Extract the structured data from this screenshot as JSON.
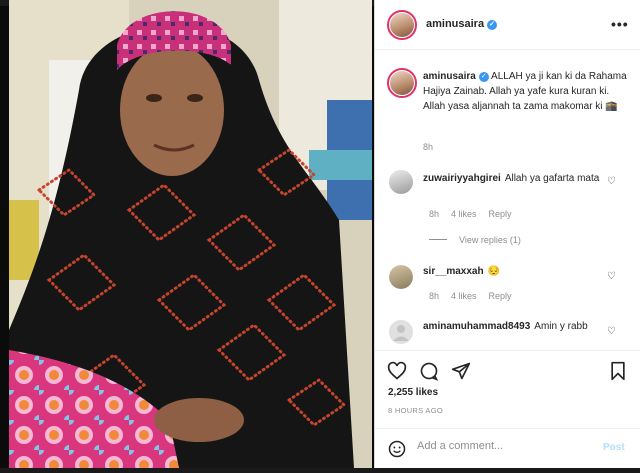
{
  "post": {
    "author": "aminusaira",
    "verified_glyph": "✓"
  },
  "header": {
    "more_glyph": "•••"
  },
  "caption": {
    "username": "aminusaira",
    "text": "ALLAH ya ji kan ki da Rahama Hajiya Zainab. Allah ya yafe kura kuran ki. Allah yasa aljannah ta zama makomar ki 🕋",
    "time": "8h"
  },
  "comments": [
    {
      "username": "zuwairiyyahgirei",
      "text": "Allah ya gafarta mata",
      "time": "8h",
      "likes": "4 likes",
      "reply": "Reply"
    },
    {
      "username": "sir__maxxah",
      "text": "😔",
      "time": "8h",
      "likes": "4 likes",
      "reply": "Reply"
    },
    {
      "username": "aminamuhammad8493",
      "text": "Amin y rabb"
    }
  ],
  "view_replies": "View replies (1)",
  "likes_count": "2,255 likes",
  "posted_ago": "8 HOURS AGO",
  "add_comment": {
    "placeholder": "Add a comment...",
    "post_label": "Post"
  },
  "icons": {
    "heart": "heart-icon",
    "comment": "comment-icon",
    "share": "share-icon",
    "save": "bookmark-icon",
    "emoji": "emoji-icon"
  },
  "colors": {
    "verified": "#3897f0",
    "post_disabled": "#b2dffc",
    "ring": "#e1306c"
  }
}
